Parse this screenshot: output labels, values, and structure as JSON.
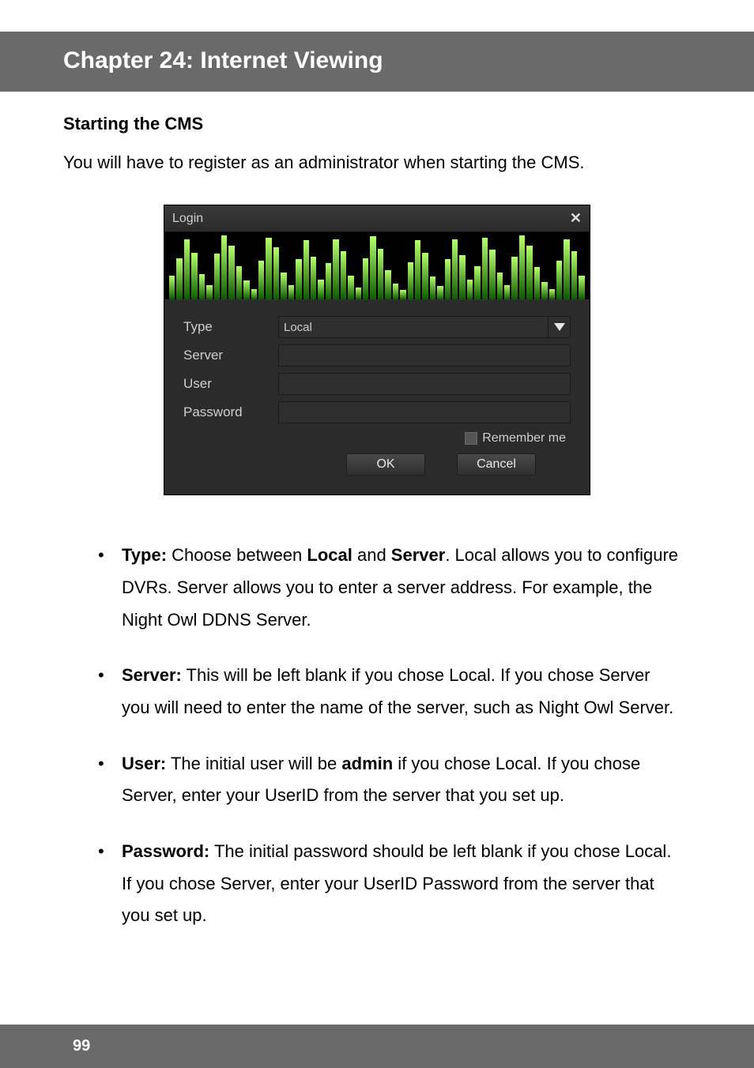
{
  "chapter": {
    "title": "Chapter 24: Internet Viewing"
  },
  "section": {
    "heading": "Starting the CMS",
    "intro": "You will have to register as an administrator when starting the CMS."
  },
  "login": {
    "title": "Login",
    "close": "✕",
    "labels": {
      "type": "Type",
      "server": "Server",
      "user": "User",
      "password": "Password"
    },
    "type_value": "Local",
    "server_value": "",
    "user_value": "",
    "password_value": "",
    "remember": "Remember me",
    "buttons": {
      "ok": "OK",
      "cancel": "Cancel"
    }
  },
  "bullets": {
    "type": {
      "label": "Type:",
      "t1": " Choose between ",
      "b1": "Local",
      "t2": " and ",
      "b2": "Server",
      "t3": ". Local allows you to configure DVRs. Server allows you to enter a server address. For example, the Night Owl DDNS Server."
    },
    "server": {
      "label": "Server:",
      "text": " This will be left blank if you chose Local. If you chose Server you will need to enter the name of the server, such as Night Owl Server."
    },
    "user": {
      "label": "User:",
      "t1": " The initial user will be ",
      "b1": "admin",
      "t2": " if you chose Local. If you chose Server, enter your UserID from the server that you set up."
    },
    "password": {
      "label": "Password:",
      "text": " The initial password should be left blank if you chose Local. If you chose Server, enter your UserID Password from the server that you set up."
    }
  },
  "footer": {
    "page": "99"
  }
}
